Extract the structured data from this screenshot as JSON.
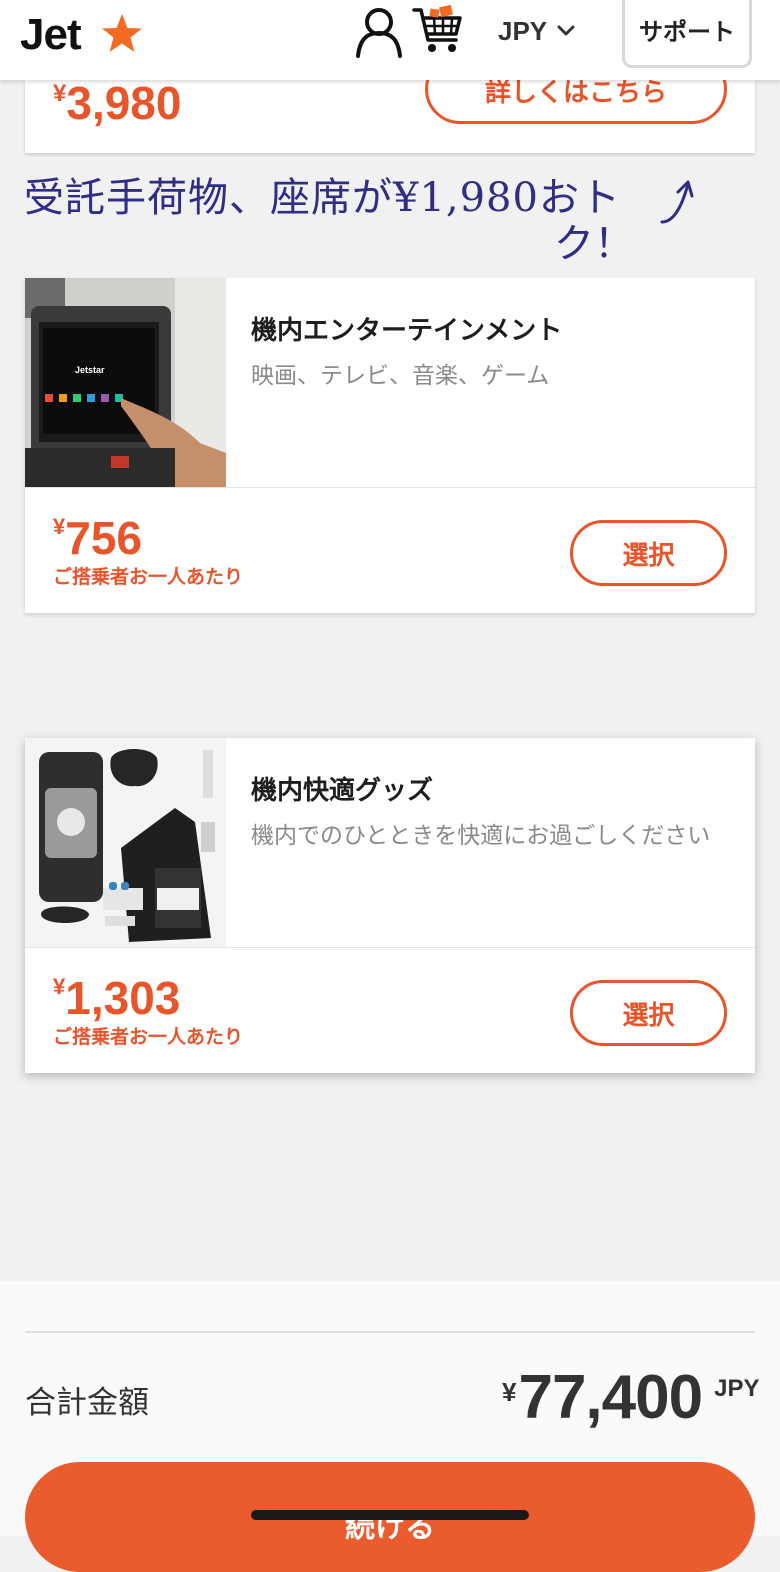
{
  "header": {
    "logo_text": "Jet",
    "logo_star_color": "#f26b21",
    "currency_label": "JPY",
    "support_label": "サポート"
  },
  "top_card": {
    "price_symbol": "¥",
    "price": "3,980",
    "details_label": "詳しくはこちら"
  },
  "annotation": {
    "line1": "受託手荷物、座席が¥1,980おト",
    "line2": "ク！",
    "color": "#2f2d86"
  },
  "products": [
    {
      "title": "機内エンターテインメント",
      "description": "映画、テレビ、音楽、ゲーム",
      "image_alt": "Jetstar",
      "price_symbol": "¥",
      "price": "756",
      "price_note": "ご搭乗者お一人あたり",
      "select_label": "選択"
    },
    {
      "title": "機内快適グッズ",
      "description": "機内でのひとときを快適にお過ごしください",
      "price_symbol": "¥",
      "price": "1,303",
      "price_note": "ご搭乗者お一人あたり",
      "select_label": "選択"
    }
  ],
  "summary": {
    "total_label": "合計金額",
    "total_symbol": "¥",
    "total_amount": "77,400",
    "total_currency": "JPY",
    "continue_label": "続ける"
  },
  "colors": {
    "accent": "#e8552a",
    "button_fill": "#ea5b2d",
    "background": "#f1f1f1"
  }
}
